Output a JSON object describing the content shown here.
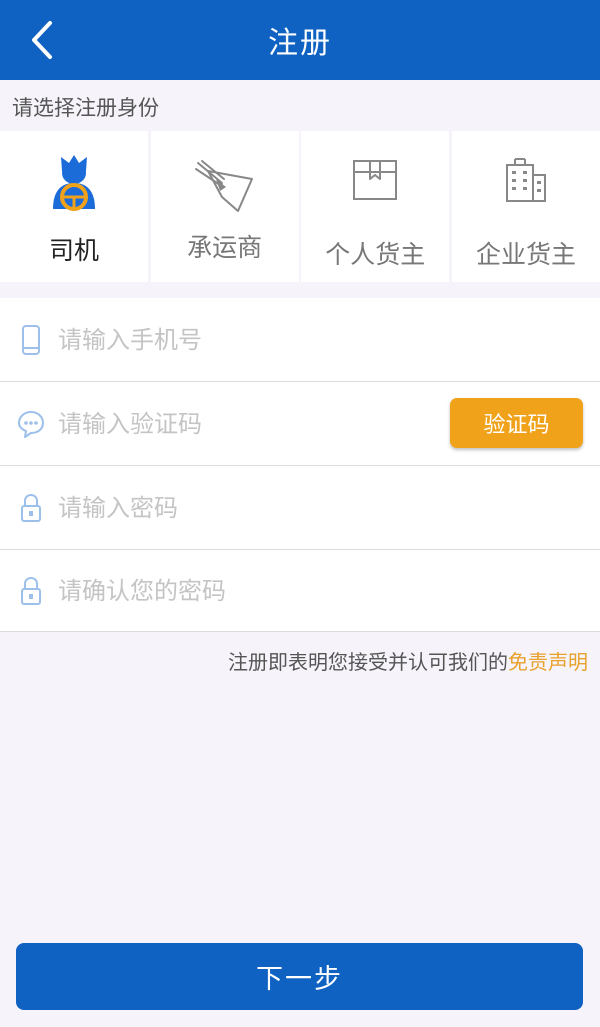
{
  "header": {
    "title": "注册",
    "back_icon": "chevron-left-icon"
  },
  "section_label": "请选择注册身份",
  "roles": [
    {
      "label": "司机",
      "icon": "driver-icon",
      "selected": true
    },
    {
      "label": "承运商",
      "icon": "carrier-icon",
      "selected": false
    },
    {
      "label": "个人货主",
      "icon": "package-icon",
      "selected": false
    },
    {
      "label": "企业货主",
      "icon": "building-icon",
      "selected": false
    }
  ],
  "form": {
    "phone": {
      "value": "",
      "placeholder": "请输入手机号",
      "icon": "phone-icon"
    },
    "code": {
      "value": "",
      "placeholder": "请输入验证码",
      "icon": "chat-icon",
      "button_label": "验证码"
    },
    "password": {
      "value": "",
      "placeholder": "请输入密码",
      "icon": "lock-icon"
    },
    "confirm": {
      "value": "",
      "placeholder": "请确认您的密码",
      "icon": "lock-icon"
    }
  },
  "agreement": {
    "text": "注册即表明您接受并认可我们的",
    "link": "免责声明"
  },
  "next_button": "下一步",
  "colors": {
    "primary": "#0f62c2",
    "accent": "#f0a21b",
    "link": "#e8a12d"
  }
}
